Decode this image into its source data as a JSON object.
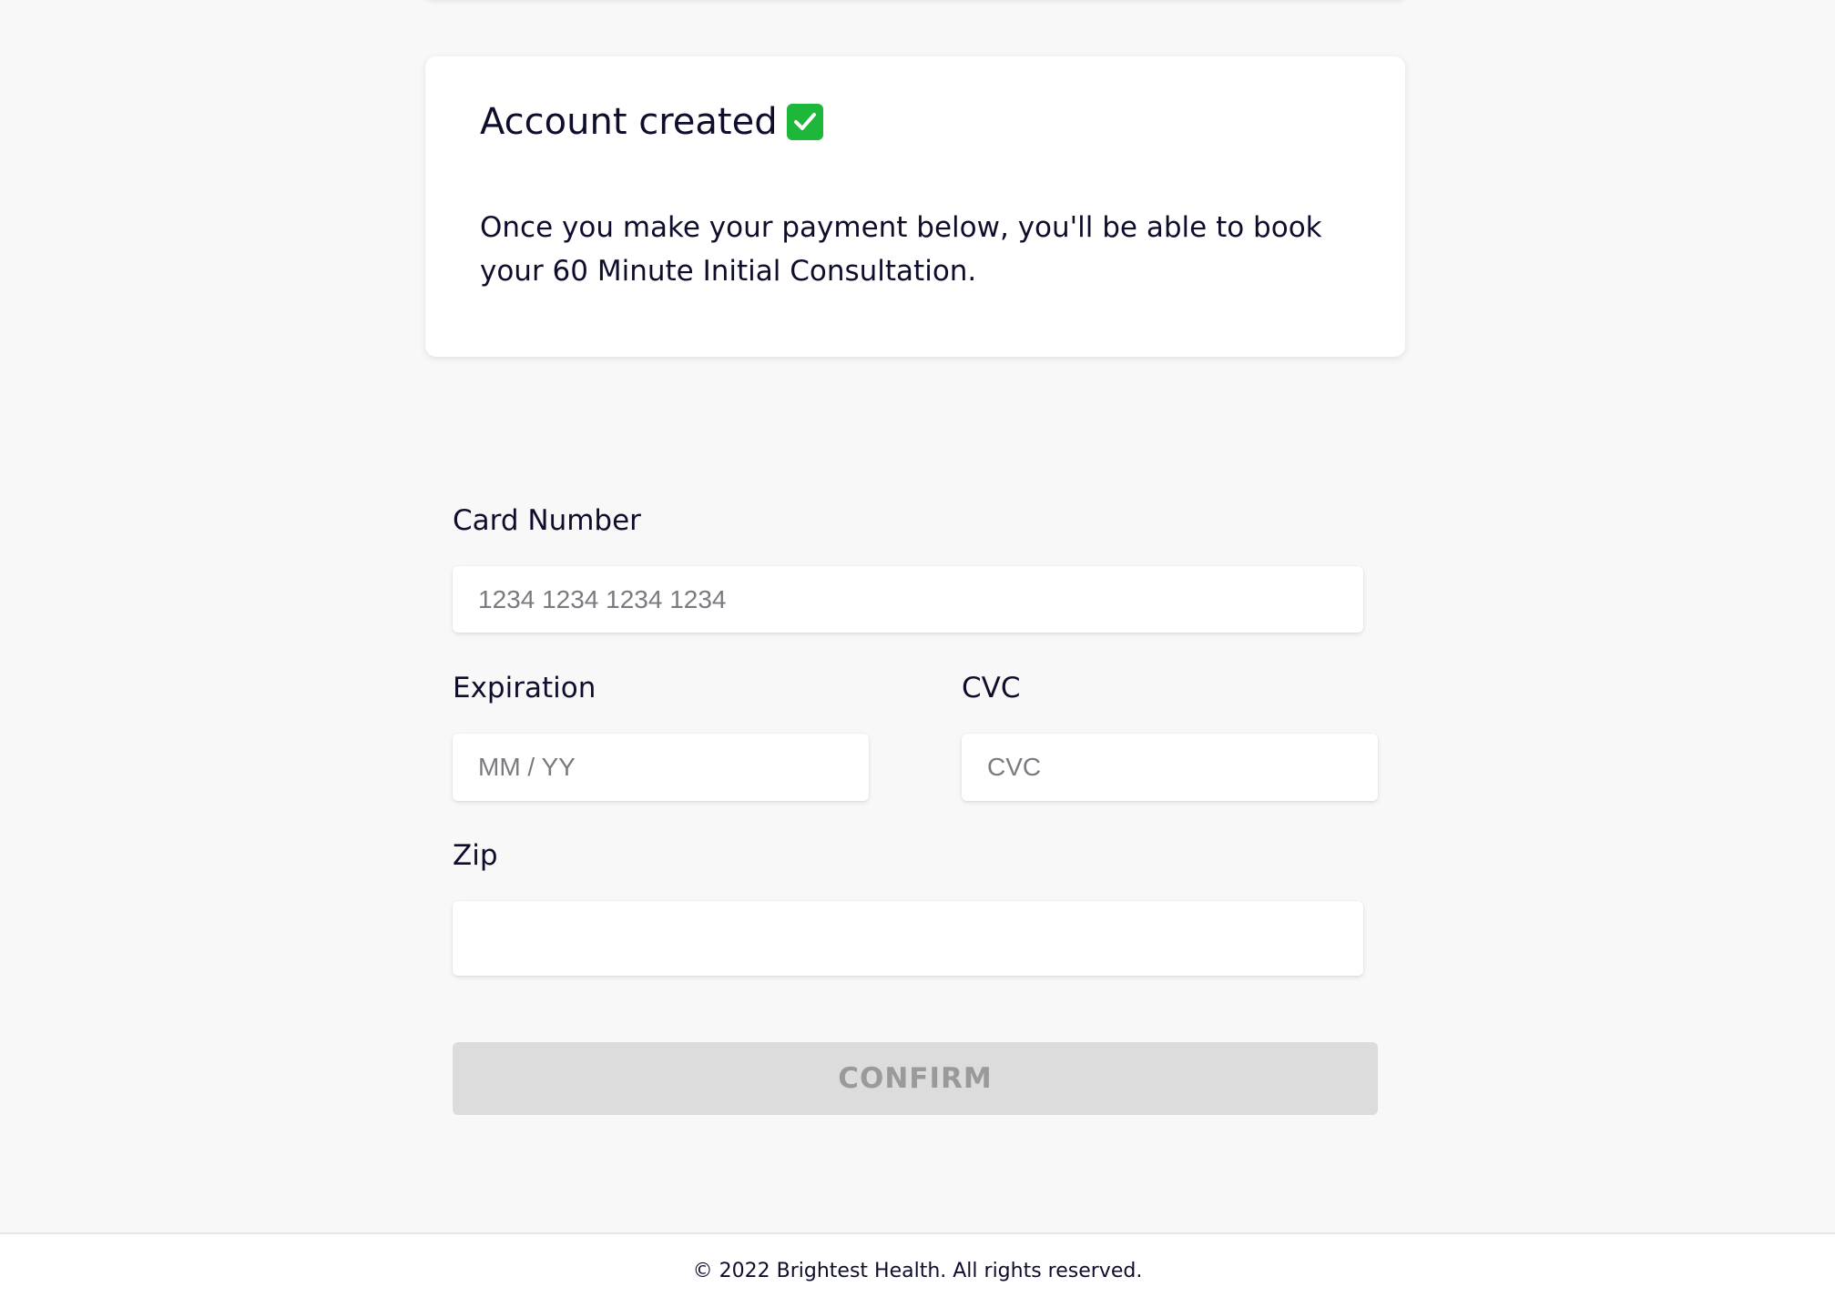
{
  "status_card": {
    "title": "Account created",
    "icon": "check-mark-button-icon",
    "body": "Once you make your payment below, you'll be able to book your 60 Minute Initial Consultation."
  },
  "payment_form": {
    "card_number": {
      "label": "Card Number",
      "placeholder": "1234 1234 1234 1234",
      "value": ""
    },
    "expiration": {
      "label": "Expiration",
      "placeholder": "MM / YY",
      "value": ""
    },
    "cvc": {
      "label": "CVC",
      "placeholder": "CVC",
      "value": ""
    },
    "zip": {
      "label": "Zip",
      "placeholder": "",
      "value": ""
    },
    "confirm_label": "CONFIRM"
  },
  "footer": {
    "text": "© 2022 Brightest Health. All rights reserved."
  },
  "colors": {
    "background": "#f8f8f9",
    "text": "#0e0e2c",
    "check_green": "#1db83a",
    "button_disabled_bg": "#dcdcdd",
    "button_disabled_text": "#9a9a9c"
  }
}
